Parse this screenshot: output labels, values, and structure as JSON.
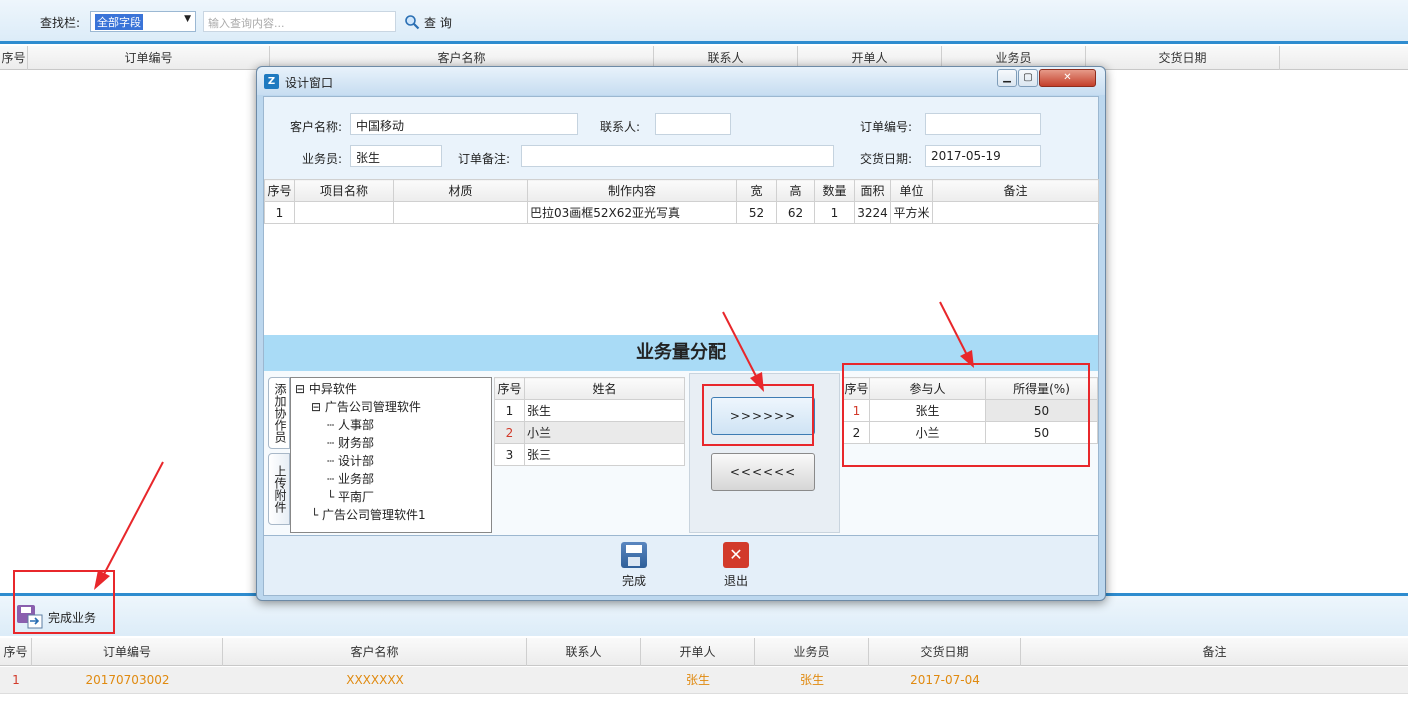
{
  "search": {
    "label": "查找栏:",
    "field": "全部字段",
    "placeholder": "输入查询内容...",
    "button": "查 询"
  },
  "upper_grid": {
    "columns": [
      "序号",
      "订单编号",
      "客户名称",
      "联系人",
      "开单人",
      "业务员",
      "交货日期"
    ]
  },
  "dialog": {
    "title": "设计窗口",
    "form": {
      "customer_label": "客户名称:",
      "customer_value": "中国移动",
      "contact_label": "联系人:",
      "contact_value": "",
      "order_no_label": "订单编号:",
      "order_no_value": "",
      "salesman_label": "业务员:",
      "salesman_value": "张生",
      "remark_label": "订单备注:",
      "remark_value": "",
      "delivery_label": "交货日期:",
      "delivery_value": "2017-05-19"
    },
    "items": {
      "columns": [
        "序号",
        "项目名称",
        "材质",
        "制作内容",
        "宽",
        "高",
        "数量",
        "面积",
        "单位",
        "备注"
      ],
      "rows": [
        [
          "1",
          "",
          "",
          "巴拉03画框52X62亚光写真",
          "52",
          "62",
          "1",
          "3224",
          "平方米",
          ""
        ]
      ]
    },
    "allocation_title": "业务量分配",
    "tabs": [
      "添加协作员",
      "上传附件"
    ],
    "tree": {
      "root": "中异软件",
      "child": "广告公司管理软件",
      "departments": [
        "人事部",
        "财务部",
        "设计部",
        "业务部",
        "平南厂"
      ],
      "sibling": "广告公司管理软件1"
    },
    "staff": {
      "columns": [
        "序号",
        "姓名"
      ],
      "rows": [
        [
          "1",
          "张生"
        ],
        [
          "2",
          "小兰"
        ],
        [
          "3",
          "张三"
        ]
      ]
    },
    "add_button": ">>>>>>",
    "remove_button": "<<<<<<",
    "participants": {
      "columns": [
        "序号",
        "参与人",
        "所得量(%)"
      ],
      "rows": [
        [
          "1",
          "张生",
          "50"
        ],
        [
          "2",
          "小兰",
          "50"
        ]
      ]
    },
    "done_button": "完成",
    "exit_button": "退出"
  },
  "bottom": {
    "finish_label": "完成业务",
    "columns": [
      "序号",
      "订单编号",
      "客户名称",
      "联系人",
      "开单人",
      "业务员",
      "交货日期",
      "备注"
    ],
    "rows": [
      [
        "1",
        "20170703002",
        "XXXXXXX",
        "",
        "张生",
        "张生",
        "2017-07-04",
        ""
      ]
    ]
  },
  "colors": {
    "accent": "#2e8ccf",
    "highlight_red": "#e8272b",
    "row_text": "#e08a10"
  }
}
